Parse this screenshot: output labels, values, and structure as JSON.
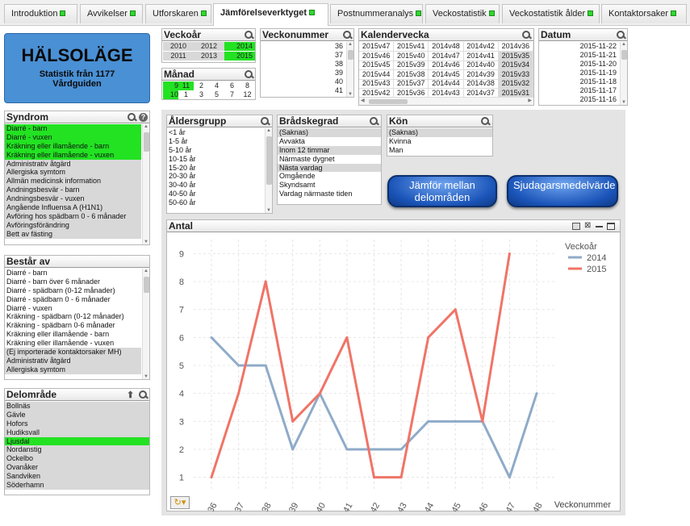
{
  "tabs": [
    {
      "label": "Introduktion"
    },
    {
      "label": "Avvikelser"
    },
    {
      "label": "Utforskaren"
    },
    {
      "label": "Jämförelseverktyget"
    },
    {
      "label": "Postnummeranalys"
    },
    {
      "label": "Veckostatistik"
    },
    {
      "label": "Veckostatistik ålder"
    },
    {
      "label": "Kontaktorsaker"
    }
  ],
  "logo": {
    "title": "HÄLSOLÄGE",
    "line1": "Statistik från 1177",
    "line2": "Vårdguiden"
  },
  "veckoar": {
    "title": "Veckoår",
    "values": [
      "2010",
      "2012",
      "2014",
      "2011",
      "2013",
      "2015"
    ]
  },
  "manad": {
    "title": "Månad",
    "values": [
      "9",
      "11",
      "2",
      "4",
      "6",
      "8",
      "10",
      "1",
      "3",
      "5",
      "7",
      "12"
    ]
  },
  "veckonummer": {
    "title": "Veckonummer",
    "values": [
      "36",
      "37",
      "38",
      "39",
      "40",
      "41"
    ]
  },
  "kalendervecka": {
    "title": "Kalendervecka",
    "rows": [
      [
        "2015v47",
        "2015v41",
        "2014v48",
        "2014v42",
        "2014v36"
      ],
      [
        "2015v46",
        "2015v40",
        "2014v47",
        "2014v41",
        "2015v35"
      ],
      [
        "2015v45",
        "2015v39",
        "2014v46",
        "2014v40",
        "2015v34"
      ],
      [
        "2015v44",
        "2015v38",
        "2014v45",
        "2014v39",
        "2015v33"
      ],
      [
        "2015v43",
        "2015v37",
        "2014v44",
        "2014v38",
        "2015v32"
      ],
      [
        "2015v42",
        "2015v36",
        "2014v43",
        "2014v37",
        "2015v31"
      ]
    ]
  },
  "datum": {
    "title": "Datum",
    "values": [
      "2015-11-22",
      "2015-11-21",
      "2015-11-20",
      "2015-11-19",
      "2015-11-18",
      "2015-11-17",
      "2015-11-16"
    ]
  },
  "syndrom": {
    "title": "Syndrom",
    "items": [
      "Diarré - barn",
      "Diarré - vuxen",
      "Kräkning eller illamående - barn",
      "Kräkning eller illamående - vuxen",
      "Administrativ åtgärd",
      "Allergiska symtom",
      "Allmän medicinsk information",
      "Andningsbesvär - barn",
      "Andningsbesvär - vuxen",
      "Angående Influensa A (H1N1)",
      "Avföring hos spädbarn 0 - 6 månader",
      "Avföringsförändring",
      "Bett av fästing"
    ]
  },
  "bestar": {
    "title": "Består av",
    "items": [
      "Diarré - barn",
      "Diarré - barn över 6 månader",
      "Diarré - spädbarn (0-12 månader)",
      "Diarré - spädbarn 0 - 6 månader",
      "Diarré - vuxen",
      "Kräkning - spädbarn (0-12 månader)",
      "Kräkning - spädbarn 0-6 månader",
      "Kräkning eller illamående - barn",
      "Kräkning eller illamående - vuxen",
      "(Ej importerade kontaktorsaker MH)",
      "Administrativ åtgärd",
      "Allergiska symtom"
    ]
  },
  "delomrade": {
    "title": "Delområde",
    "items": [
      "Bollnäs",
      "Gävle",
      "Hofors",
      "Hudiksvall",
      "Ljusdal",
      "Nordanstig",
      "Ockelbo",
      "Ovanåker",
      "Sandviken",
      "Söderhamn"
    ]
  },
  "aldersgrupp": {
    "title": "Åldersgrupp",
    "items": [
      "<1 år",
      "1-5 år",
      "5-10 år",
      "10-15 år",
      "15-20 år",
      "20-30 år",
      "30-40 år",
      "40-50 år",
      "50-60 år"
    ]
  },
  "bradskegrad": {
    "title": "Brådskegrad",
    "items": [
      "(Saknas)",
      "Avvakta",
      "Inom 12 timmar",
      "Närmaste dygnet",
      "Nästa vardag",
      "Omgående",
      "Skyndsamt",
      "Vardag närmaste tiden"
    ]
  },
  "kon": {
    "title": "Kön",
    "items": [
      "(Saknas)",
      "Kvinna",
      "Man"
    ]
  },
  "buttons": {
    "compare": "Jämför mellan delområden",
    "sjudagars": "Sjudagarsmedelvärde"
  },
  "chart_title": "Antal",
  "chart_data": {
    "type": "line",
    "x": [
      36,
      37,
      38,
      39,
      40,
      41,
      42,
      43,
      44,
      45,
      46,
      47,
      48
    ],
    "series": [
      {
        "name": "2014",
        "color": "#8fabc9",
        "values": [
          6,
          5,
          5,
          2,
          4,
          2,
          2,
          2,
          3,
          3,
          3,
          1,
          4
        ]
      },
      {
        "name": "2015",
        "color": "#f07467",
        "values": [
          1,
          4,
          8,
          3,
          4,
          6,
          1,
          1,
          6,
          7,
          3,
          9,
          null
        ]
      }
    ],
    "xlabel": "Veckonummer",
    "ylabel": "",
    "ylim": [
      0.5,
      9.5
    ],
    "yticks": [
      1,
      2,
      3,
      4,
      5,
      6,
      7,
      8,
      9
    ],
    "legend_title": "Veckoår",
    "legend_position": "top-right",
    "grid": true
  }
}
